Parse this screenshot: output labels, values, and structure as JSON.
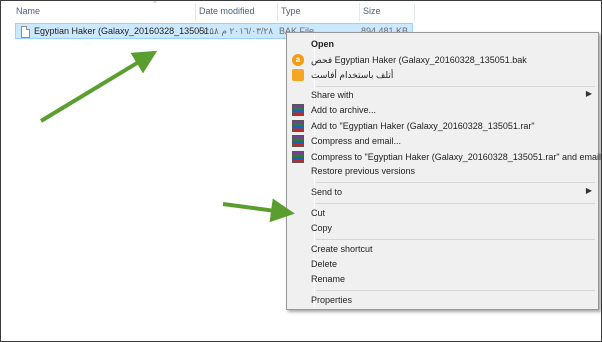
{
  "columns": [
    {
      "label": "Name"
    },
    {
      "label": "Date modified"
    },
    {
      "label": "Type"
    },
    {
      "label": "Size"
    }
  ],
  "file": {
    "name": "Egyptian Haker (Galaxy_20160328_135051...",
    "date": "٢٠١٦/٠٣/٢٨ م ٠١:٥٨",
    "type": "BAK File",
    "size": "894,481 KB"
  },
  "context_menu": {
    "open": "Open",
    "scan": "فحص Egyptian Haker (Galaxy_20160328_135051.bak",
    "delete_forever": "أتلف باستخدام أفاست",
    "share_with": "Share with",
    "add_to_archive": "Add to archive...",
    "add_to_rar": "Add to \"Egyptian Haker (Galaxy_20160328_135051.rar\"",
    "compress_email": "Compress and email...",
    "compress_to_rar_email": "Compress to \"Egyptian Haker (Galaxy_20160328_135051.rar\" and email",
    "restore_versions": "Restore previous versions",
    "send_to": "Send to",
    "cut": "Cut",
    "copy": "Copy",
    "create_shortcut": "Create shortcut",
    "delete": "Delete",
    "rename": "Rename",
    "properties": "Properties"
  },
  "colors": {
    "selection": "#cce8ff",
    "arrow": "#5a9e2f"
  }
}
